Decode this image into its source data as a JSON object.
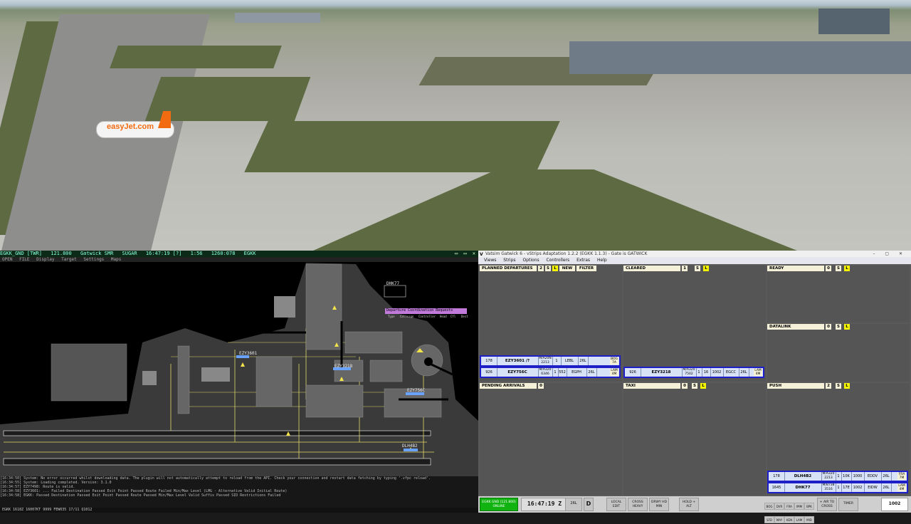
{
  "scene": {
    "aircraft_livery": "easyJet.com"
  },
  "radar": {
    "top_bar_items": [
      "EGKK_GND [TWR]",
      "121.800",
      "Gatwick SMR",
      "SUGAR",
      "16:47:19 [?]",
      "1:56",
      "1260:078",
      "EGKK"
    ],
    "menu_items": [
      "OPEN",
      "FILE",
      "Display",
      "Target",
      "Settings",
      "Maps"
    ],
    "tags": [
      "EZY3601",
      "EZY3218",
      "EZY756C",
      "DLH4B2",
      "DHK77"
    ],
    "depart_window_title": "Departure Coordination Requests",
    "depart_window_cols": [
      "Type",
      "Callsign",
      "Controller",
      "Head",
      "Cfl",
      "Dest"
    ],
    "log": [
      "[16:34:50] System: No error occurred whilst downloading data. The plugin will not automatically attempt to reload from the API. Check your connection and restart data fetching by typing '.vfpc reload'.",
      "[16:34:55] System: Loading completed. Version: 3.1.0",
      "[16:34:57] EZY7498: Route is valid.",
      "[16:34:58] EZY3601: ... Failed Destination  Passed Exit Point  Passed Route  Failed Min/Max Level (LMG - Alternative Valid Initial Route)",
      "[16:34:58] EGKK: Passed Destination  Passed Exit Point  Passed Route  Passed Min/Max Level  Valid Suffix  Passed SID Restrictions  Failed"
    ],
    "cmd_text": "EGKK 1618Z 16007KT 9999 FEW035 17/11 Q1012"
  },
  "efs": {
    "title": "Vatsim Gatwick 6 - vStrips Adaptation 1.2.2 (EGKK 1.1.3) - Gate is GATWICK",
    "menu": [
      "Views",
      "Strips",
      "Options",
      "Controllers",
      "Extras",
      "Help"
    ],
    "bays": {
      "planned_departures": {
        "name": "PLANNED DEPARTURES",
        "b1": "2",
        "b2": "S",
        "b3": "L",
        "new": "NEW",
        "filter": "FILTER"
      },
      "cleared": {
        "name": "CLEARED",
        "b1": "1",
        "b2": "S",
        "b3": "L"
      },
      "ready": {
        "name": "READY",
        "b1": "0",
        "b2": "S",
        "b3": "L"
      },
      "datalink": {
        "name": "DATALINK",
        "b1": "0",
        "b2": "S",
        "b3": "L"
      },
      "pending_arrivals": {
        "name": "PENDING ARRIVALS",
        "b1": "0"
      },
      "taxi": {
        "name": "TAXI",
        "b1": "0",
        "b2": "S",
        "b3": "L"
      },
      "push": {
        "name": "PUSH",
        "b1": "2",
        "b2": "S",
        "b3": "L"
      }
    },
    "strips": {
      "ezy3601": {
        "stand": "178",
        "callsign": "EZY3601 /?",
        "type": "M/A20N",
        "sq": "2213",
        "r": "1",
        "dest": "LEBL",
        "rwy": "26L",
        "rt": "BOG 7A"
      },
      "ezy756c": {
        "stand": "926",
        "callsign": "EZY756C",
        "type": "M/A320",
        "sq": "6346",
        "r": "1",
        "alt": "552",
        "dest": "EGPH",
        "rwy": "26L",
        "rt": "LAM 4M"
      },
      "ezy3218": {
        "stand": "926",
        "callsign": "EZY3218",
        "type": "M/A320",
        "sq": "7502",
        "r": "1",
        "alt": "16",
        "fl": "1002",
        "dest": "EGCC",
        "rwy": "26L",
        "rt": "LAM 4M"
      },
      "dlh4b2": {
        "stand": "178",
        "callsign": "DLH4B2",
        "type": "M/A320",
        "sq": "2213",
        "r": "1",
        "alt": "10K",
        "fl": "1000",
        "dest": "EDDV",
        "rwy": "26L",
        "rt": "FRA 7M"
      },
      "dhk77": {
        "stand": "1645",
        "callsign": "DHK77",
        "type": "M/B738",
        "sq": "3516",
        "r": "1",
        "alt": "17E",
        "fl": "1002",
        "dest": "EIDW",
        "rwy": "26L",
        "rt": "LAM 4M"
      }
    },
    "bottom": {
      "freq": "EGKK GND (121.800)",
      "freq_sub": "ONLINE",
      "clock": "16:47:19 Z",
      "runway": "26L",
      "mode": "D",
      "buttons": [
        "LOCAL EDIT",
        "CROSS HEAVY",
        "DRWY HD MIN",
        "HOLD + ALT",
        "+ AIR TO CROSS",
        "TIMER"
      ],
      "grid": [
        "BOG",
        "DVR",
        "FRA",
        "IMM",
        "BPK",
        "SFD",
        "MAY",
        "KEN",
        "LAM",
        "MID",
        "NOV",
        "DOV",
        "SAM",
        "SFD",
        "KEN"
      ],
      "qnh": "1002"
    }
  }
}
